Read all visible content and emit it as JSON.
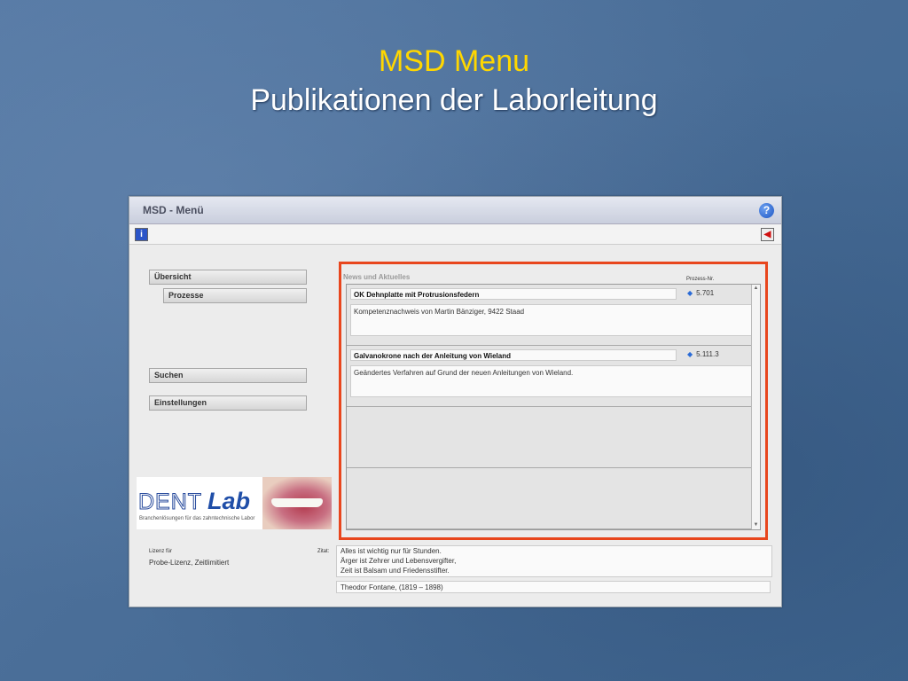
{
  "slide": {
    "title": "MSD Menu",
    "subtitle": "Publikationen der Laborleitung"
  },
  "window": {
    "title": "MSD - Menü",
    "help_icon": "question-circle-icon",
    "info_icon": "info-icon",
    "exit_icon": "exit-door-icon"
  },
  "nav": {
    "overview": "Übersicht",
    "processes": "Prozesse",
    "search": "Suchen",
    "settings": "Einstellungen"
  },
  "logo": {
    "dent": "DENT",
    "lab": "Lab",
    "tagline": "Branchenlösungen für das zahntechnische Labor"
  },
  "news": {
    "header": "News und Aktuelles",
    "process_header": "Prozess-Nr.",
    "items": [
      {
        "title": "OK Dehnplatte mit Protrusionsfedern",
        "process": "5.701",
        "description": "Kompetenznachweis von Martin Bänziger, 9422 Staad"
      },
      {
        "title": "Galvanokrone nach der Anleitung von Wieland",
        "process": "5.111.3",
        "description": "Geändertes Verfahren auf Grund der neuen Anleitungen von Wieland."
      }
    ]
  },
  "license": {
    "label": "Lizenz für",
    "value": "Probe-Lizenz, Zeitlimitiert"
  },
  "quote": {
    "label": "Zitat:",
    "lines": [
      "Alles ist wichtig nur für Stunden.",
      "Ärger ist Zehrer und Lebensvergifter,",
      "Zeit ist Balsam und Friedensstifter."
    ],
    "author": "Theodor Fontane, (1819 – 1898)"
  },
  "colors": {
    "highlight": "#e8461d",
    "title_yellow": "#ffd700",
    "background": "#4a6e98"
  }
}
